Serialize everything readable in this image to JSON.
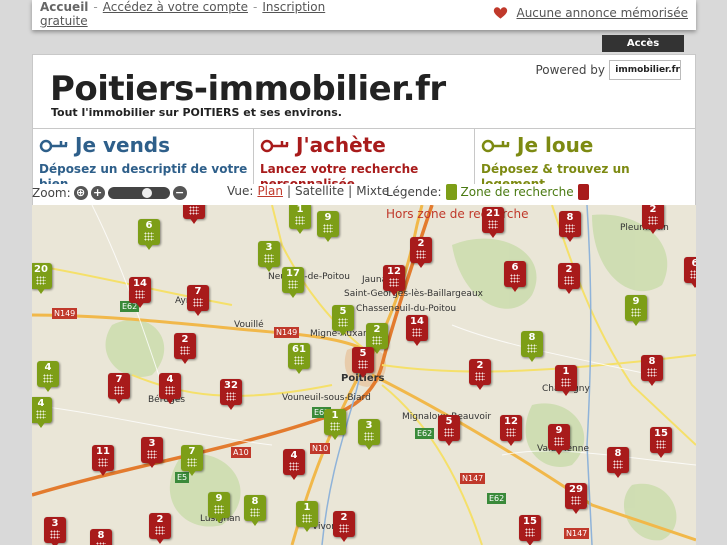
{
  "topbar": {
    "home": "Accueil",
    "separator": "-",
    "account": "Accédez à votre compte",
    "signup": "Inscription gratuite",
    "memorized": "Aucune annonce mémorisée",
    "heart_icon": "heart-icon"
  },
  "agences_button": "Accès Agences",
  "header": {
    "title": "Poitiers-immobilier.fr",
    "tagline": "Tout l'immobilier sur POITIERS et ses environs.",
    "powered_by": "Powered by",
    "partner_logo": "immobilier.fr"
  },
  "tabs": [
    {
      "title": "Je vends",
      "desc": "Déposez un descriptif de votre bien",
      "color": "#2e5f8a",
      "icon": "key-icon"
    },
    {
      "title": "J'achète",
      "desc": "Lancez votre recherche personnalisée",
      "color": "#a81b1b",
      "icon": "key-icon"
    },
    {
      "title": "Je loue",
      "desc": "Déposez & trouvez un logement",
      "color": "#7d8a12",
      "icon": "key-icon"
    }
  ],
  "controls": {
    "zoom_label": "Zoom:",
    "view_label": "Vue:",
    "view_plan": "Plan",
    "view_satellite": "Satellite",
    "view_mixte": "Mixte",
    "view_sep": "|",
    "legend_label": "Légende:",
    "zone_in": "Zone de recherche",
    "zone_out": "Hors zone de recherche"
  },
  "colors": {
    "marker_red": "#a81b1b",
    "marker_green": "#7d9e17"
  },
  "map": {
    "markers": [
      {
        "count": "2",
        "zone": "out"
      },
      {
        "count": "1",
        "zone": "in"
      },
      {
        "count": "9",
        "zone": "in"
      },
      {
        "count": "21",
        "zone": "out"
      },
      {
        "count": "8",
        "zone": "out"
      },
      {
        "count": "2",
        "zone": "out"
      },
      {
        "count": "6",
        "zone": "in"
      },
      {
        "count": "3",
        "zone": "in"
      },
      {
        "count": "2",
        "zone": "out"
      },
      {
        "count": "20",
        "zone": "in"
      },
      {
        "count": "17",
        "zone": "in"
      },
      {
        "count": "12",
        "zone": "out"
      },
      {
        "count": "6",
        "zone": "out"
      },
      {
        "count": "2",
        "zone": "out"
      },
      {
        "count": "6",
        "zone": "out"
      },
      {
        "count": "14",
        "zone": "out"
      },
      {
        "count": "7",
        "zone": "out"
      },
      {
        "count": "9",
        "zone": "in"
      },
      {
        "count": "5",
        "zone": "in"
      },
      {
        "count": "2",
        "zone": "in"
      },
      {
        "count": "14",
        "zone": "out"
      },
      {
        "count": "2",
        "zone": "out"
      },
      {
        "count": "8",
        "zone": "in"
      },
      {
        "count": "61",
        "zone": "in"
      },
      {
        "count": "5",
        "zone": "out"
      },
      {
        "count": "4",
        "zone": "in"
      },
      {
        "count": "2",
        "zone": "out"
      },
      {
        "count": "8",
        "zone": "out"
      },
      {
        "count": "7",
        "zone": "out"
      },
      {
        "count": "4",
        "zone": "out"
      },
      {
        "count": "32",
        "zone": "out"
      },
      {
        "count": "1",
        "zone": "out"
      },
      {
        "count": "4",
        "zone": "in"
      },
      {
        "count": "1",
        "zone": "in"
      },
      {
        "count": "3",
        "zone": "in"
      },
      {
        "count": "5",
        "zone": "out"
      },
      {
        "count": "12",
        "zone": "out"
      },
      {
        "count": "9",
        "zone": "out"
      },
      {
        "count": "15",
        "zone": "out"
      },
      {
        "count": "3",
        "zone": "out"
      },
      {
        "count": "11",
        "zone": "out"
      },
      {
        "count": "7",
        "zone": "in"
      },
      {
        "count": "4",
        "zone": "out"
      },
      {
        "count": "8",
        "zone": "out"
      },
      {
        "count": "29",
        "zone": "out"
      },
      {
        "count": "9",
        "zone": "in"
      },
      {
        "count": "8",
        "zone": "in"
      },
      {
        "count": "1",
        "zone": "in"
      },
      {
        "count": "2",
        "zone": "out"
      },
      {
        "count": "15",
        "zone": "out"
      },
      {
        "count": "2",
        "zone": "out"
      },
      {
        "count": "3",
        "zone": "out"
      },
      {
        "count": "8",
        "zone": "out"
      }
    ],
    "places": [
      "Neuville-de-Poitou",
      "Jaunay",
      "Saint-Georges-lès-Baillargeaux",
      "Chasseneuil-du-Poitou",
      "Vouillé",
      "Migné-Auxances",
      "Poitiers",
      "Vouneuil-sous-Biard",
      "Mignaloux-Beauvoir",
      "Chauvigny",
      "Pleumartin",
      "Ayron",
      "Béruges",
      "Lusignan",
      "Vivonne",
      "Valdivienne"
    ],
    "roads": [
      "N149",
      "E62",
      "N149",
      "E62",
      "N10",
      "E62",
      "A10",
      "E5",
      "N147",
      "E62",
      "N147"
    ]
  }
}
